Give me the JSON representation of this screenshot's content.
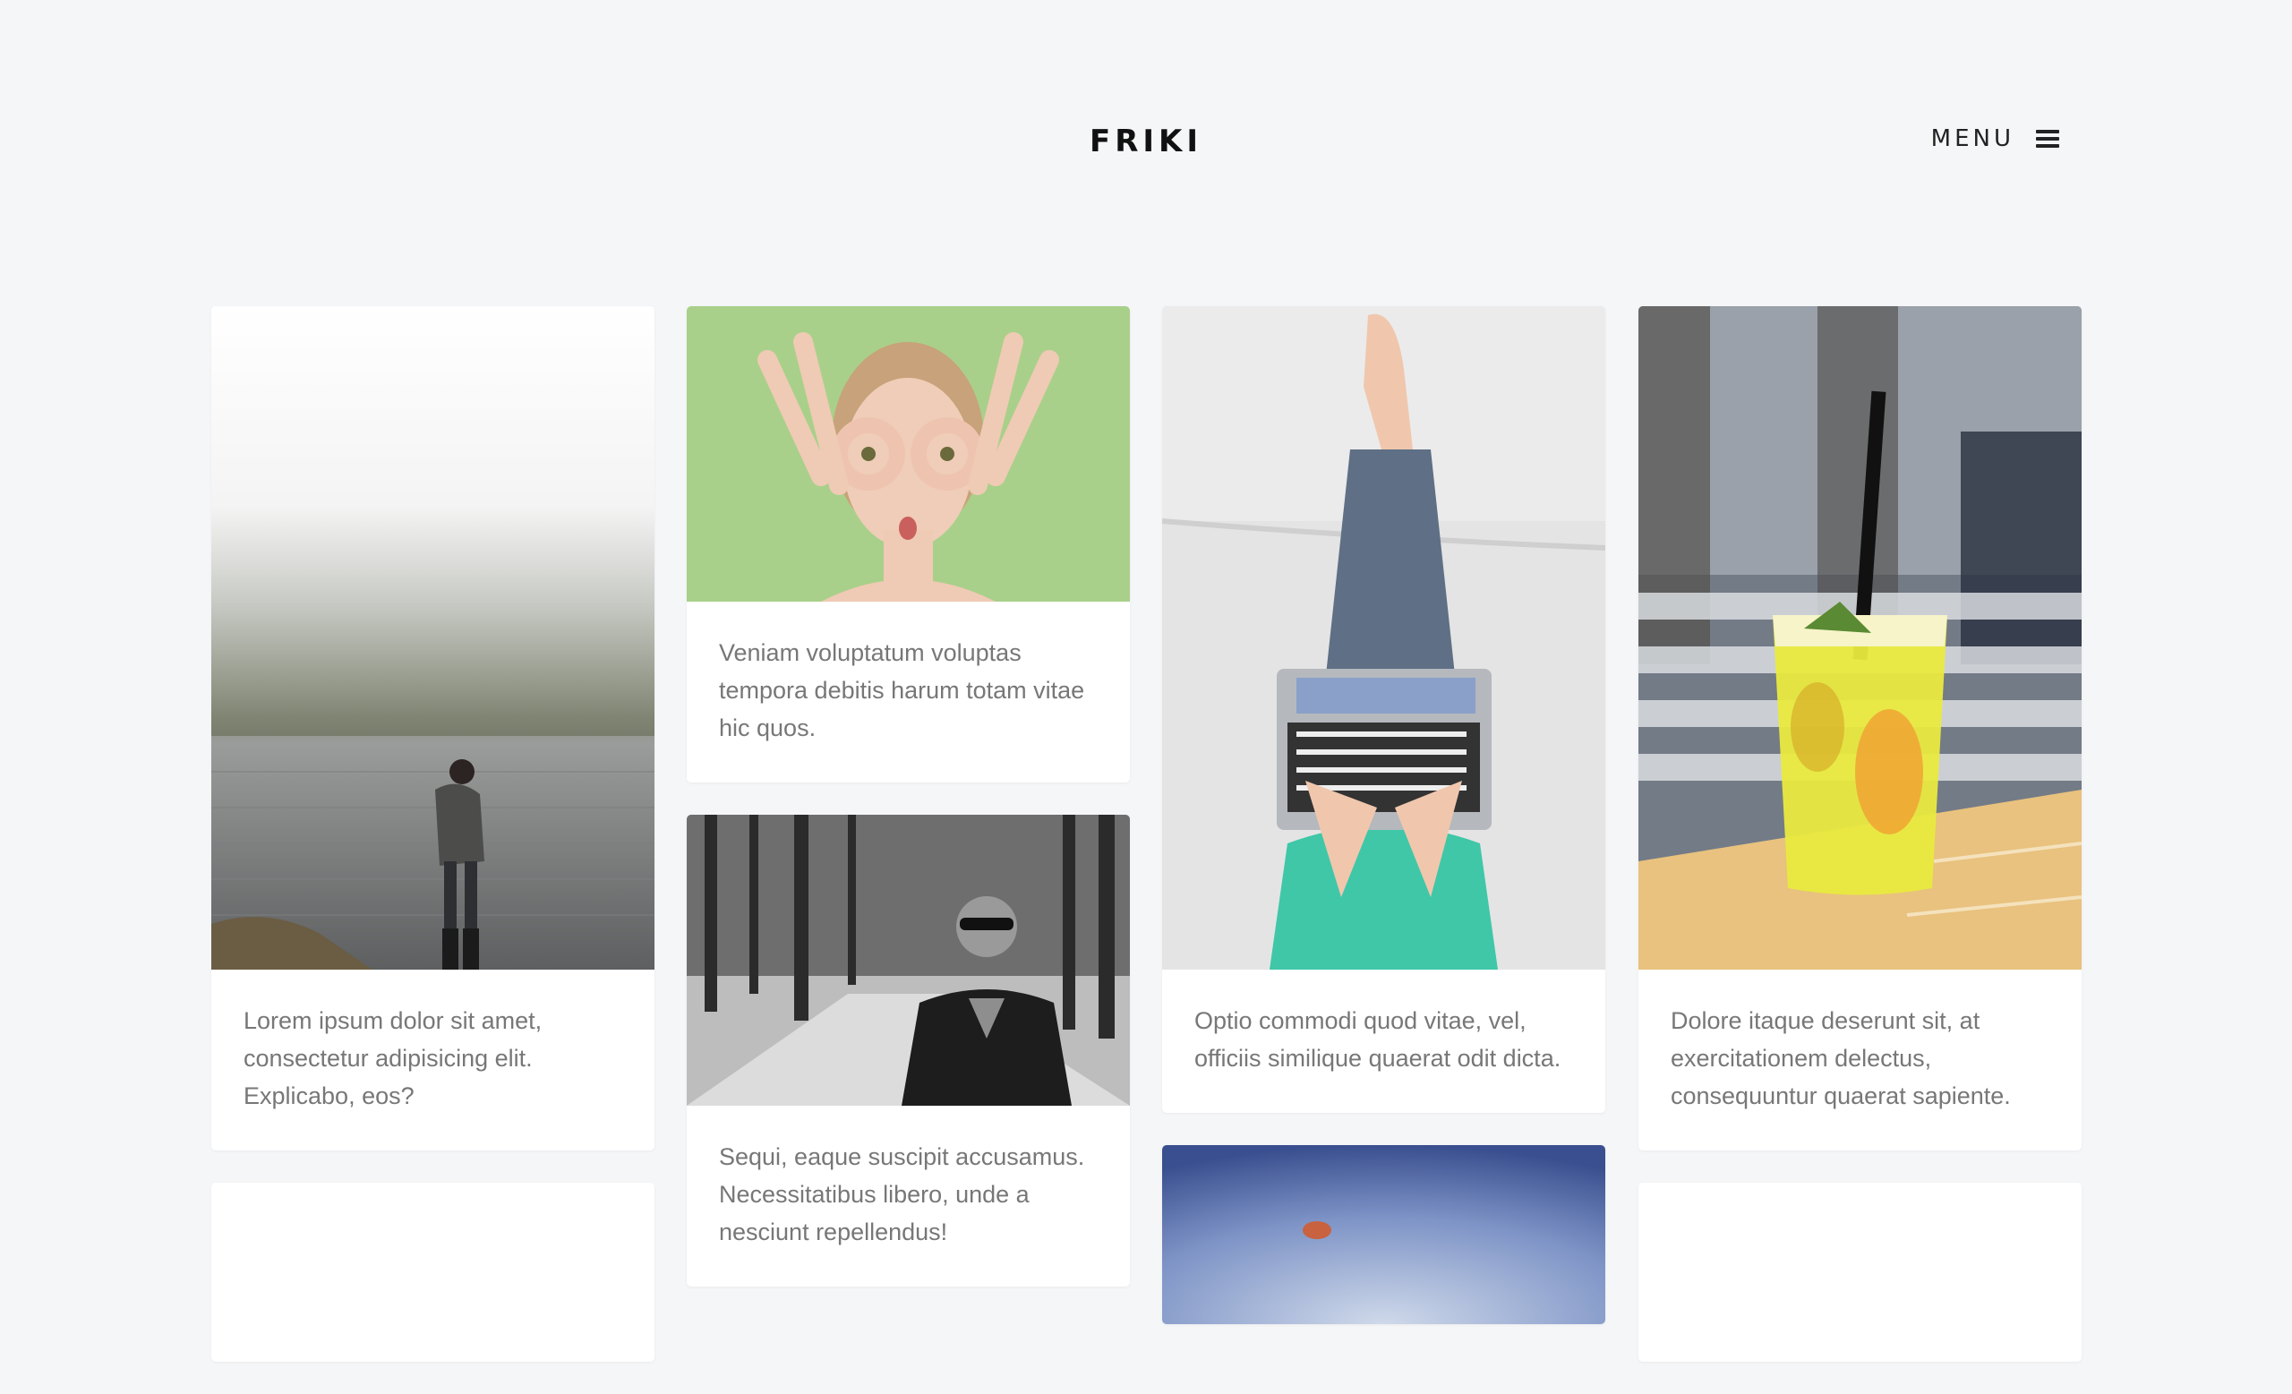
{
  "header": {
    "logo": "FRIKI",
    "menu_label": "MENU"
  },
  "cards": [
    {
      "text": "Lorem ipsum dolor sit amet, consectetur adipisicing elit. Explicabo, eos?",
      "image": "foggy-lake-person"
    },
    {
      "text": "Veniam voluptatum voluptas tempora debitis harum totam vitae hic quos.",
      "image": "woman-finger-goggles"
    },
    {
      "text": "Sequi, eaque suscipit accusamus. Necessitatibus libero, unde a nesciunt repellendus!",
      "image": "woman-sunglasses-forest"
    },
    {
      "text": "Optio commodi quod vitae, vel, officiis similique quaerat odit dicta.",
      "image": "laptop-on-legs"
    },
    {
      "text": "Dolore itaque deserunt sit, at exercitationem delectus, consequuntur quaerat sapiente.",
      "image": "lemonade-glass"
    }
  ],
  "colors": {
    "background": "#f5f6f8",
    "card": "#ffffff",
    "text": "#777777",
    "logo": "#111111"
  }
}
